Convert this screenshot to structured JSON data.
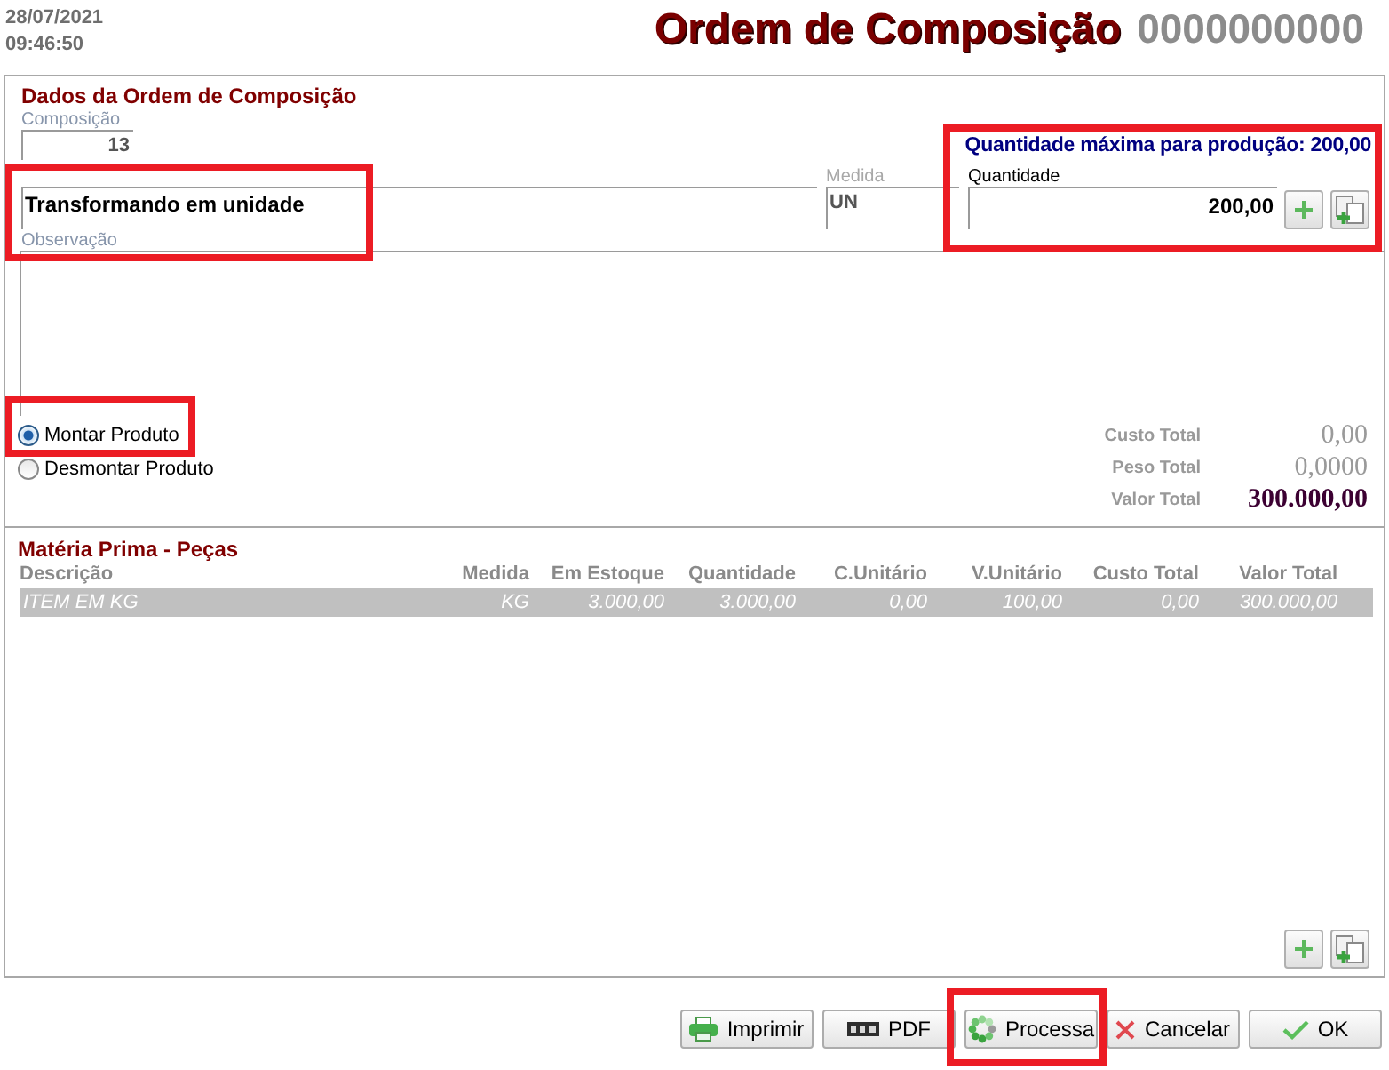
{
  "header": {
    "date": "28/07/2021",
    "time": "09:46:50",
    "title": "Ordem de Composição",
    "number": "0000000000"
  },
  "order": {
    "title": "Dados da Ordem de Composição",
    "composition": {
      "label": "Composição",
      "value": "13"
    },
    "description": {
      "value": "Transformando em unidade",
      "highlighted": true
    },
    "observation": {
      "label": "Observação"
    },
    "unit": {
      "label": "Medida",
      "value": "UN"
    },
    "quantity_panel": {
      "max_text": "Quantidade máxima para produção: 200,00",
      "label": "Quantidade",
      "value": "200,00",
      "highlighted": true
    },
    "modes": [
      {
        "label": "Montar Produto",
        "selected": true,
        "highlighted": true
      },
      {
        "label": "Desmontar Produto",
        "selected": false,
        "highlighted": false
      }
    ],
    "totals": [
      {
        "kind": "plain",
        "label": "Custo Total",
        "value": "0,00"
      },
      {
        "kind": "plain",
        "label": "Peso Total",
        "value": "0,0000"
      },
      {
        "kind": "grand",
        "label": "Valor Total",
        "value": "300.000,00"
      }
    ]
  },
  "materials": {
    "title": "Matéria Prima - Peças",
    "columns": [
      "Descrição",
      "Medida",
      "Em Estoque",
      "Quantidade",
      "C.Unitário",
      "V.Unitário",
      "Custo Total",
      "Valor Total"
    ],
    "rows": [
      {
        "selected": true,
        "cells": [
          "ITEM EM KG",
          "KG",
          "3.000,00",
          "3.000,00",
          "0,00",
          "100,00",
          "0,00",
          "300.000,00"
        ]
      }
    ]
  },
  "buttons": [
    {
      "kind": "print",
      "label": "Imprimir",
      "highlighted": false
    },
    {
      "kind": "pdf",
      "label": "PDF",
      "highlighted": false
    },
    {
      "kind": "process",
      "label": "Processa",
      "highlighted": true
    },
    {
      "kind": "cancel",
      "label": "Cancelar",
      "highlighted": false
    },
    {
      "kind": "ok",
      "label": "OK",
      "highlighted": false
    }
  ]
}
